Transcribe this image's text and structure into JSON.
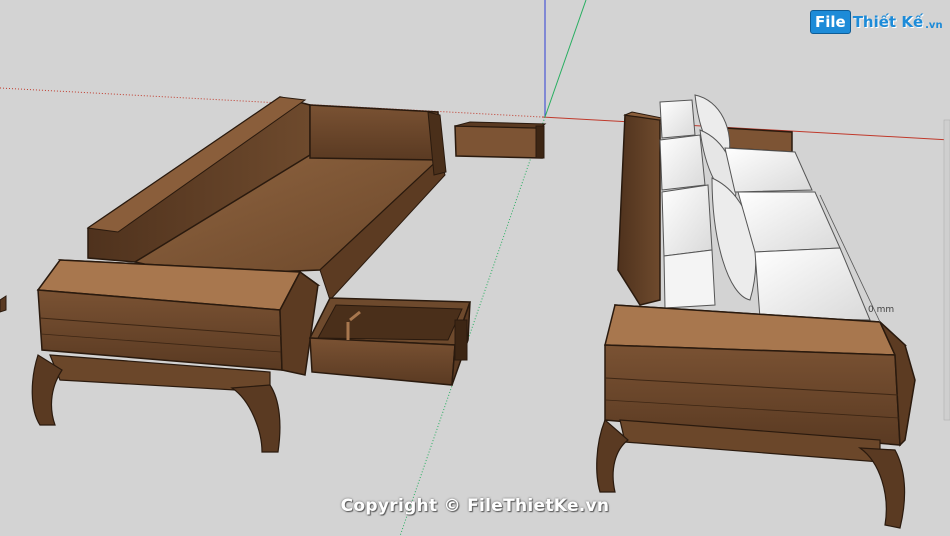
{
  "watermark": {
    "logo_box": "File",
    "logo_name": "Thiết Kế",
    "logo_ext": ".vn"
  },
  "copyright": "Copyright © FileThietKe.vn",
  "dimension_label": "0 mm",
  "colors": {
    "background": "#d3d3d3",
    "wood_dark": "#5a3a22",
    "wood_mid": "#8a5e3b",
    "wood_light": "#a8774e",
    "cushion": "#eeeeee",
    "axis_red": "#c0392b",
    "axis_green": "#27ae60",
    "axis_blue": "#2c3ed6",
    "logo_blue": "#1d8bd8"
  }
}
